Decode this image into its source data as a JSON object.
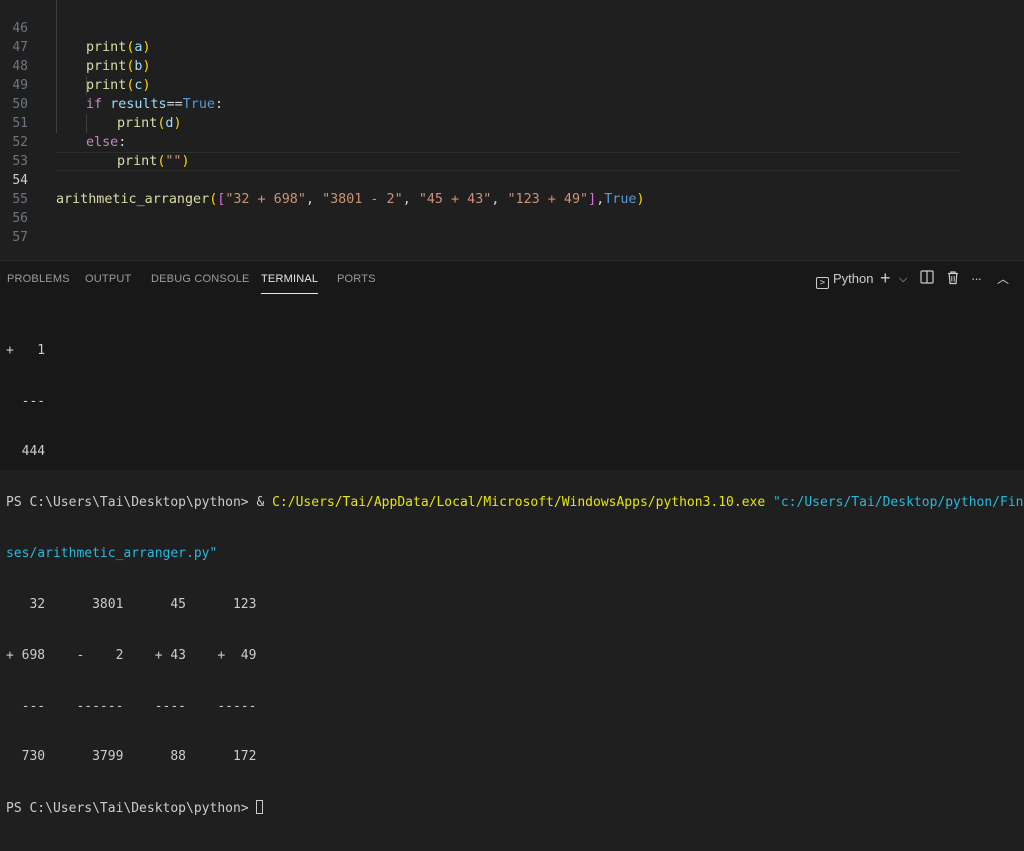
{
  "editor": {
    "lines": [
      {
        "num": "46"
      },
      {
        "num": "47"
      },
      {
        "num": "48"
      },
      {
        "num": "49"
      },
      {
        "num": "50"
      },
      {
        "num": "51"
      },
      {
        "num": "52"
      },
      {
        "num": "53"
      },
      {
        "num": "54"
      },
      {
        "num": "55"
      },
      {
        "num": "56"
      },
      {
        "num": "57"
      }
    ],
    "tokens": {
      "print": "print",
      "lp": "(",
      "rp": ")",
      "a": "a",
      "b": "b",
      "c": "c",
      "d": "d",
      "if": "if",
      "results": "results",
      "eqeq": "==",
      "true": "True",
      "colon": ":",
      "else": "else",
      "empty_str": "\"\"",
      "fn_call": "arithmetic_arranger",
      "lb": "[",
      "rb": "]",
      "s1": "\"32 + 698\"",
      "s2": "\"3801 - 2\"",
      "s3": "\"45 + 43\"",
      "s4": "\"123 + 49\"",
      "comma_sp": ", ",
      "comma": ","
    }
  },
  "panel": {
    "tabs": [
      "PROBLEMS",
      "OUTPUT",
      "DEBUG CONSOLE",
      "TERMINAL",
      "PORTS"
    ],
    "active_tab": "TERMINAL",
    "terminal_name": "Python",
    "plus": "+",
    "chevron": "⌵",
    "more": "···",
    "maximize": "︿",
    "term_glyph": ">"
  },
  "terminal": {
    "pre_lines": [
      "+   1",
      "  ---",
      "  444"
    ],
    "prompt": "PS C:\\Users\\Tai\\Desktop\\python> ",
    "cmd_amp": "& ",
    "cmd_exe": "C:/Users/Tai/AppData/Local/Microsoft/WindowsApps/python3.10.exe",
    "cmd_arg_1": " \"c:/Users/Tai/Desktop/python/Final Exerci",
    "cmd_arg_2": "ses/arithmetic_arranger.py\"",
    "output_lines": [
      "   32      3801      45      123",
      "+ 698    -    2    + 43    +  49",
      "  ---    ------    ----    -----",
      "  730      3799      88      172"
    ],
    "final_prompt": "PS C:\\Users\\Tai\\Desktop\\python> "
  }
}
